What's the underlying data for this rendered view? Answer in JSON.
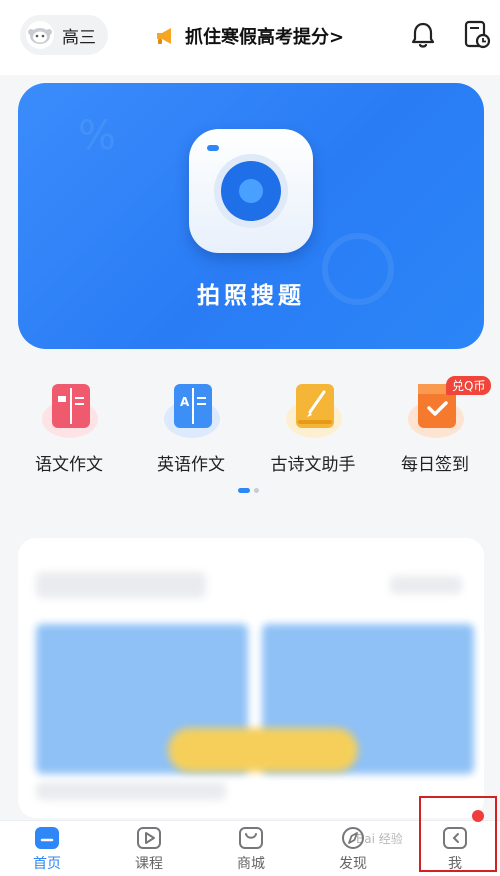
{
  "header": {
    "grade_label": "高三",
    "promo_text": "抓住寒假高考提分>"
  },
  "hero": {
    "label": "拍照搜题"
  },
  "tools": [
    {
      "label": "语文作文",
      "icon": "chinese-essay-icon",
      "color": "#f05a6e"
    },
    {
      "label": "英语作文",
      "icon": "english-essay-icon",
      "color": "#3d8ef5"
    },
    {
      "label": "古诗文助手",
      "icon": "poetry-assistant-icon",
      "color": "#f5b536"
    },
    {
      "label": "每日签到",
      "icon": "daily-checkin-icon",
      "color": "#f57a2e",
      "badge": "兑Q币"
    }
  ],
  "tabs": [
    {
      "label": "首页",
      "icon": "home-icon",
      "active": true
    },
    {
      "label": "课程",
      "icon": "course-icon"
    },
    {
      "label": "商城",
      "icon": "mall-icon"
    },
    {
      "label": "发现",
      "icon": "discover-icon"
    },
    {
      "label": "我",
      "icon": "me-icon"
    }
  ],
  "colors": {
    "accent": "#2f86f6",
    "hero_bg": "#2a7cf5",
    "highlight_box": "#d32020"
  }
}
